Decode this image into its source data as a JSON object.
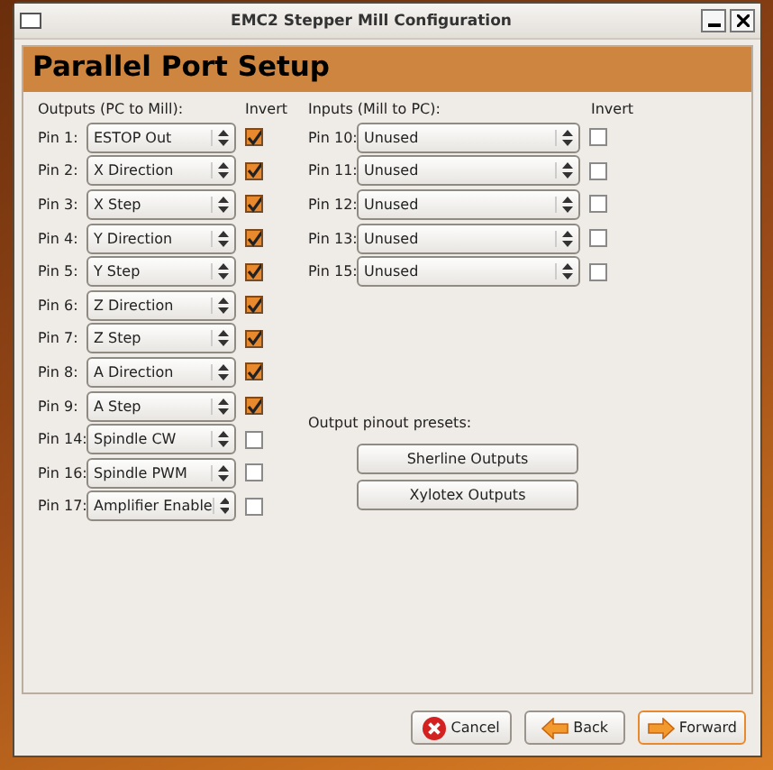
{
  "window": {
    "title": "EMC2 Stepper Mill Configuration"
  },
  "header": "Parallel Port Setup",
  "outputs": {
    "heading": "Outputs (PC to Mill):",
    "invert_heading": "Invert",
    "pins": [
      {
        "label": "Pin 1:",
        "value": "ESTOP Out",
        "invert": true
      },
      {
        "label": "Pin 2:",
        "value": "X Direction",
        "invert": true
      },
      {
        "label": "Pin 3:",
        "value": "X Step",
        "invert": true
      },
      {
        "label": "Pin 4:",
        "value": "Y Direction",
        "invert": true
      },
      {
        "label": "Pin 5:",
        "value": "Y Step",
        "invert": true
      },
      {
        "label": "Pin 6:",
        "value": "Z Direction",
        "invert": true
      },
      {
        "label": "Pin 7:",
        "value": "Z Step",
        "invert": true
      },
      {
        "label": "Pin 8:",
        "value": "A Direction",
        "invert": true
      },
      {
        "label": "Pin 9:",
        "value": "A Step",
        "invert": true
      },
      {
        "label": "Pin 14:",
        "value": "Spindle CW",
        "invert": false
      },
      {
        "label": "Pin 16:",
        "value": "Spindle PWM",
        "invert": false
      },
      {
        "label": "Pin 17:",
        "value": "Amplifier Enable",
        "invert": false
      }
    ]
  },
  "inputs": {
    "heading": "Inputs (Mill to PC):",
    "invert_heading": "Invert",
    "pins": [
      {
        "label": "Pin 10:",
        "value": "Unused",
        "invert": false
      },
      {
        "label": "Pin 11:",
        "value": "Unused",
        "invert": false
      },
      {
        "label": "Pin 12:",
        "value": "Unused",
        "invert": false
      },
      {
        "label": "Pin 13:",
        "value": "Unused",
        "invert": false
      },
      {
        "label": "Pin 15:",
        "value": "Unused",
        "invert": false
      }
    ]
  },
  "presets": {
    "heading": "Output pinout presets:",
    "buttons": [
      "Sherline Outputs",
      "Xylotex Outputs"
    ]
  },
  "buttons": [
    {
      "label": "Cancel",
      "kind": "cancel",
      "default": false
    },
    {
      "label": "Back",
      "kind": "back",
      "default": false
    },
    {
      "label": "Forward",
      "kind": "forward",
      "default": true
    }
  ]
}
